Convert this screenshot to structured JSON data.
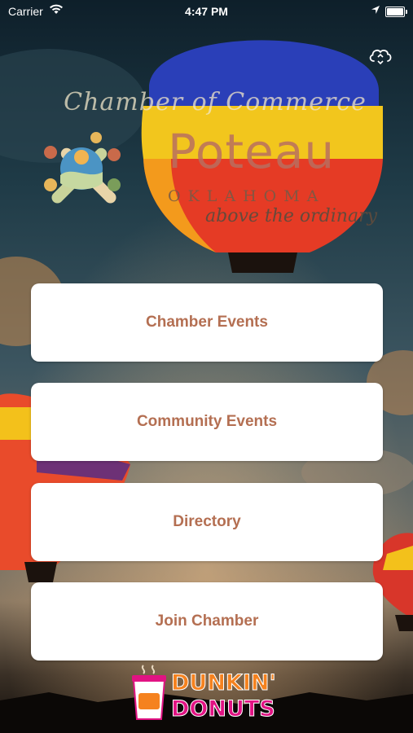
{
  "status_bar": {
    "carrier": "Carrier",
    "time": "4:47 PM"
  },
  "header": {
    "sync_icon": "cloud-sync-icon"
  },
  "logo": {
    "script_text": "Chamber of Commerce",
    "city": "Poteau",
    "state": "OKLAHOMA",
    "tagline": "above the ordinary"
  },
  "menu": [
    {
      "label": "Chamber Events"
    },
    {
      "label": "Community Events"
    },
    {
      "label": "Directory"
    },
    {
      "label": "Join Chamber"
    }
  ],
  "sponsor": {
    "brand_top": "DUNKIN'",
    "brand_bottom": "DONUTS"
  },
  "colors": {
    "button_text": "#b46f52",
    "button_bg": "#ffffff",
    "dunkin_orange": "#f5821f",
    "dunkin_pink": "#e11383"
  }
}
